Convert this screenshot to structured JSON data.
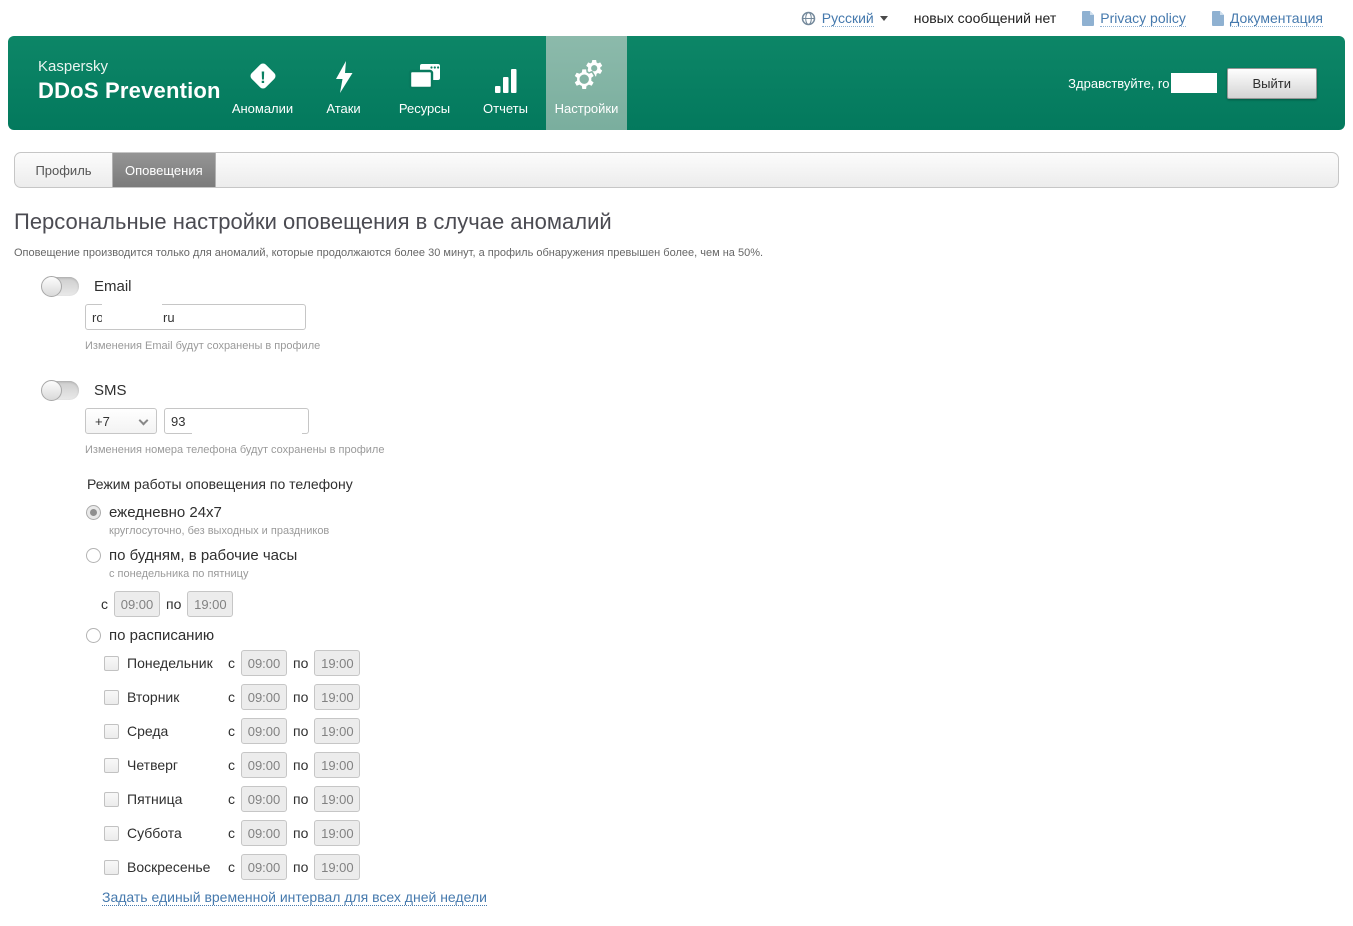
{
  "topbar": {
    "language": "Русский",
    "messages": "новых сообщений нет",
    "privacy": "Privacy policy",
    "docs": "Документация"
  },
  "header": {
    "brand_line1": "Kaspersky",
    "brand_line2": "DDoS Prevention",
    "nav": [
      {
        "label": "Аномалии",
        "icon": "anomaly-diamond-icon",
        "active": false
      },
      {
        "label": "Атаки",
        "icon": "lightning-icon",
        "active": false
      },
      {
        "label": "Ресурсы",
        "icon": "windows-icon",
        "active": false
      },
      {
        "label": "Отчеты",
        "icon": "bar-chart-icon",
        "active": false
      },
      {
        "label": "Настройки",
        "icon": "gear-icon",
        "active": true
      }
    ],
    "greeting": "Здравствуйте, ro",
    "logout": "Выйти"
  },
  "tabs": [
    {
      "label": "Профиль",
      "active": false
    },
    {
      "label": "Оповещения",
      "active": true
    }
  ],
  "page": {
    "title": "Персональные настройки оповещения в случае аномалий",
    "subtitle": "Оповещение производится только для аномалий, которые продолжаются более 30 минут, а профиль обнаружения превышен более, чем на 50%."
  },
  "email": {
    "label": "Email",
    "enabled": false,
    "value_prefix": "ro",
    "value_suffix": "ru",
    "note": "Изменения Email будут сохранены в профиле"
  },
  "sms": {
    "label": "SMS",
    "enabled": false,
    "country_code": "+7",
    "phone_prefix": "93",
    "note": "Изменения номера телефона будут сохранены в профиле"
  },
  "schedule": {
    "heading": "Режим работы оповещения по телефону",
    "from_label": "с",
    "to_label": "по",
    "options": [
      {
        "label": "ежедневно 24x7",
        "note": "круглосуточно, без выходных и праздников",
        "selected": true
      },
      {
        "label": "по будням, в рабочие часы",
        "note": "с понедельника по пятницу",
        "selected": false
      },
      {
        "label": "по расписанию",
        "selected": false
      }
    ],
    "weekday_from": "09:00",
    "weekday_to": "19:00",
    "days": [
      {
        "label": "Понедельник",
        "from": "09:00",
        "to": "19:00",
        "checked": false
      },
      {
        "label": "Вторник",
        "from": "09:00",
        "to": "19:00",
        "checked": false
      },
      {
        "label": "Среда",
        "from": "09:00",
        "to": "19:00",
        "checked": false
      },
      {
        "label": "Четверг",
        "from": "09:00",
        "to": "19:00",
        "checked": false
      },
      {
        "label": "Пятница",
        "from": "09:00",
        "to": "19:00",
        "checked": false
      },
      {
        "label": "Суббота",
        "from": "09:00",
        "to": "19:00",
        "checked": false
      },
      {
        "label": "Воскресенье",
        "from": "09:00",
        "to": "19:00",
        "checked": false
      }
    ],
    "link": "Задать единый временной интервал для всех дней недели"
  },
  "colors": {
    "header_green": "#087f63",
    "active_nav_green": "#7fb2a3",
    "link_blue": "#4579ad",
    "active_tab_gray": "#8a8a8a"
  }
}
